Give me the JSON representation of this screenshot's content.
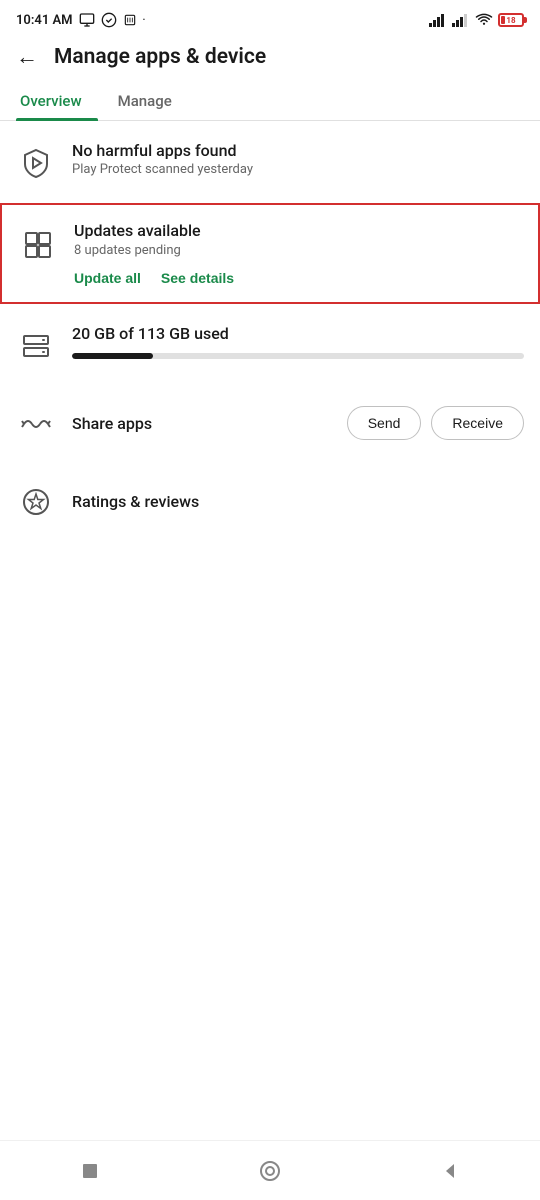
{
  "statusBar": {
    "time": "10:41 AM",
    "batteryPercent": "18",
    "batteryColor": "#d32f2f"
  },
  "header": {
    "backLabel": "←",
    "title": "Manage apps & device"
  },
  "tabs": [
    {
      "id": "overview",
      "label": "Overview",
      "active": true
    },
    {
      "id": "manage",
      "label": "Manage",
      "active": false
    }
  ],
  "sections": {
    "playProtect": {
      "title": "No harmful apps found",
      "subtitle": "Play Protect scanned yesterday"
    },
    "updates": {
      "title": "Updates available",
      "subtitle": "8 updates pending",
      "updateAllLabel": "Update all",
      "seeDetailsLabel": "See details"
    },
    "storage": {
      "title": "20 GB of 113 GB used",
      "usedGB": 20,
      "totalGB": 113,
      "fillPercent": 18
    },
    "shareApps": {
      "title": "Share apps",
      "sendLabel": "Send",
      "receiveLabel": "Receive"
    },
    "ratings": {
      "title": "Ratings & reviews"
    }
  },
  "navBar": {
    "squareLabel": "■",
    "circleLabel": "○",
    "triangleLabel": "◁"
  }
}
